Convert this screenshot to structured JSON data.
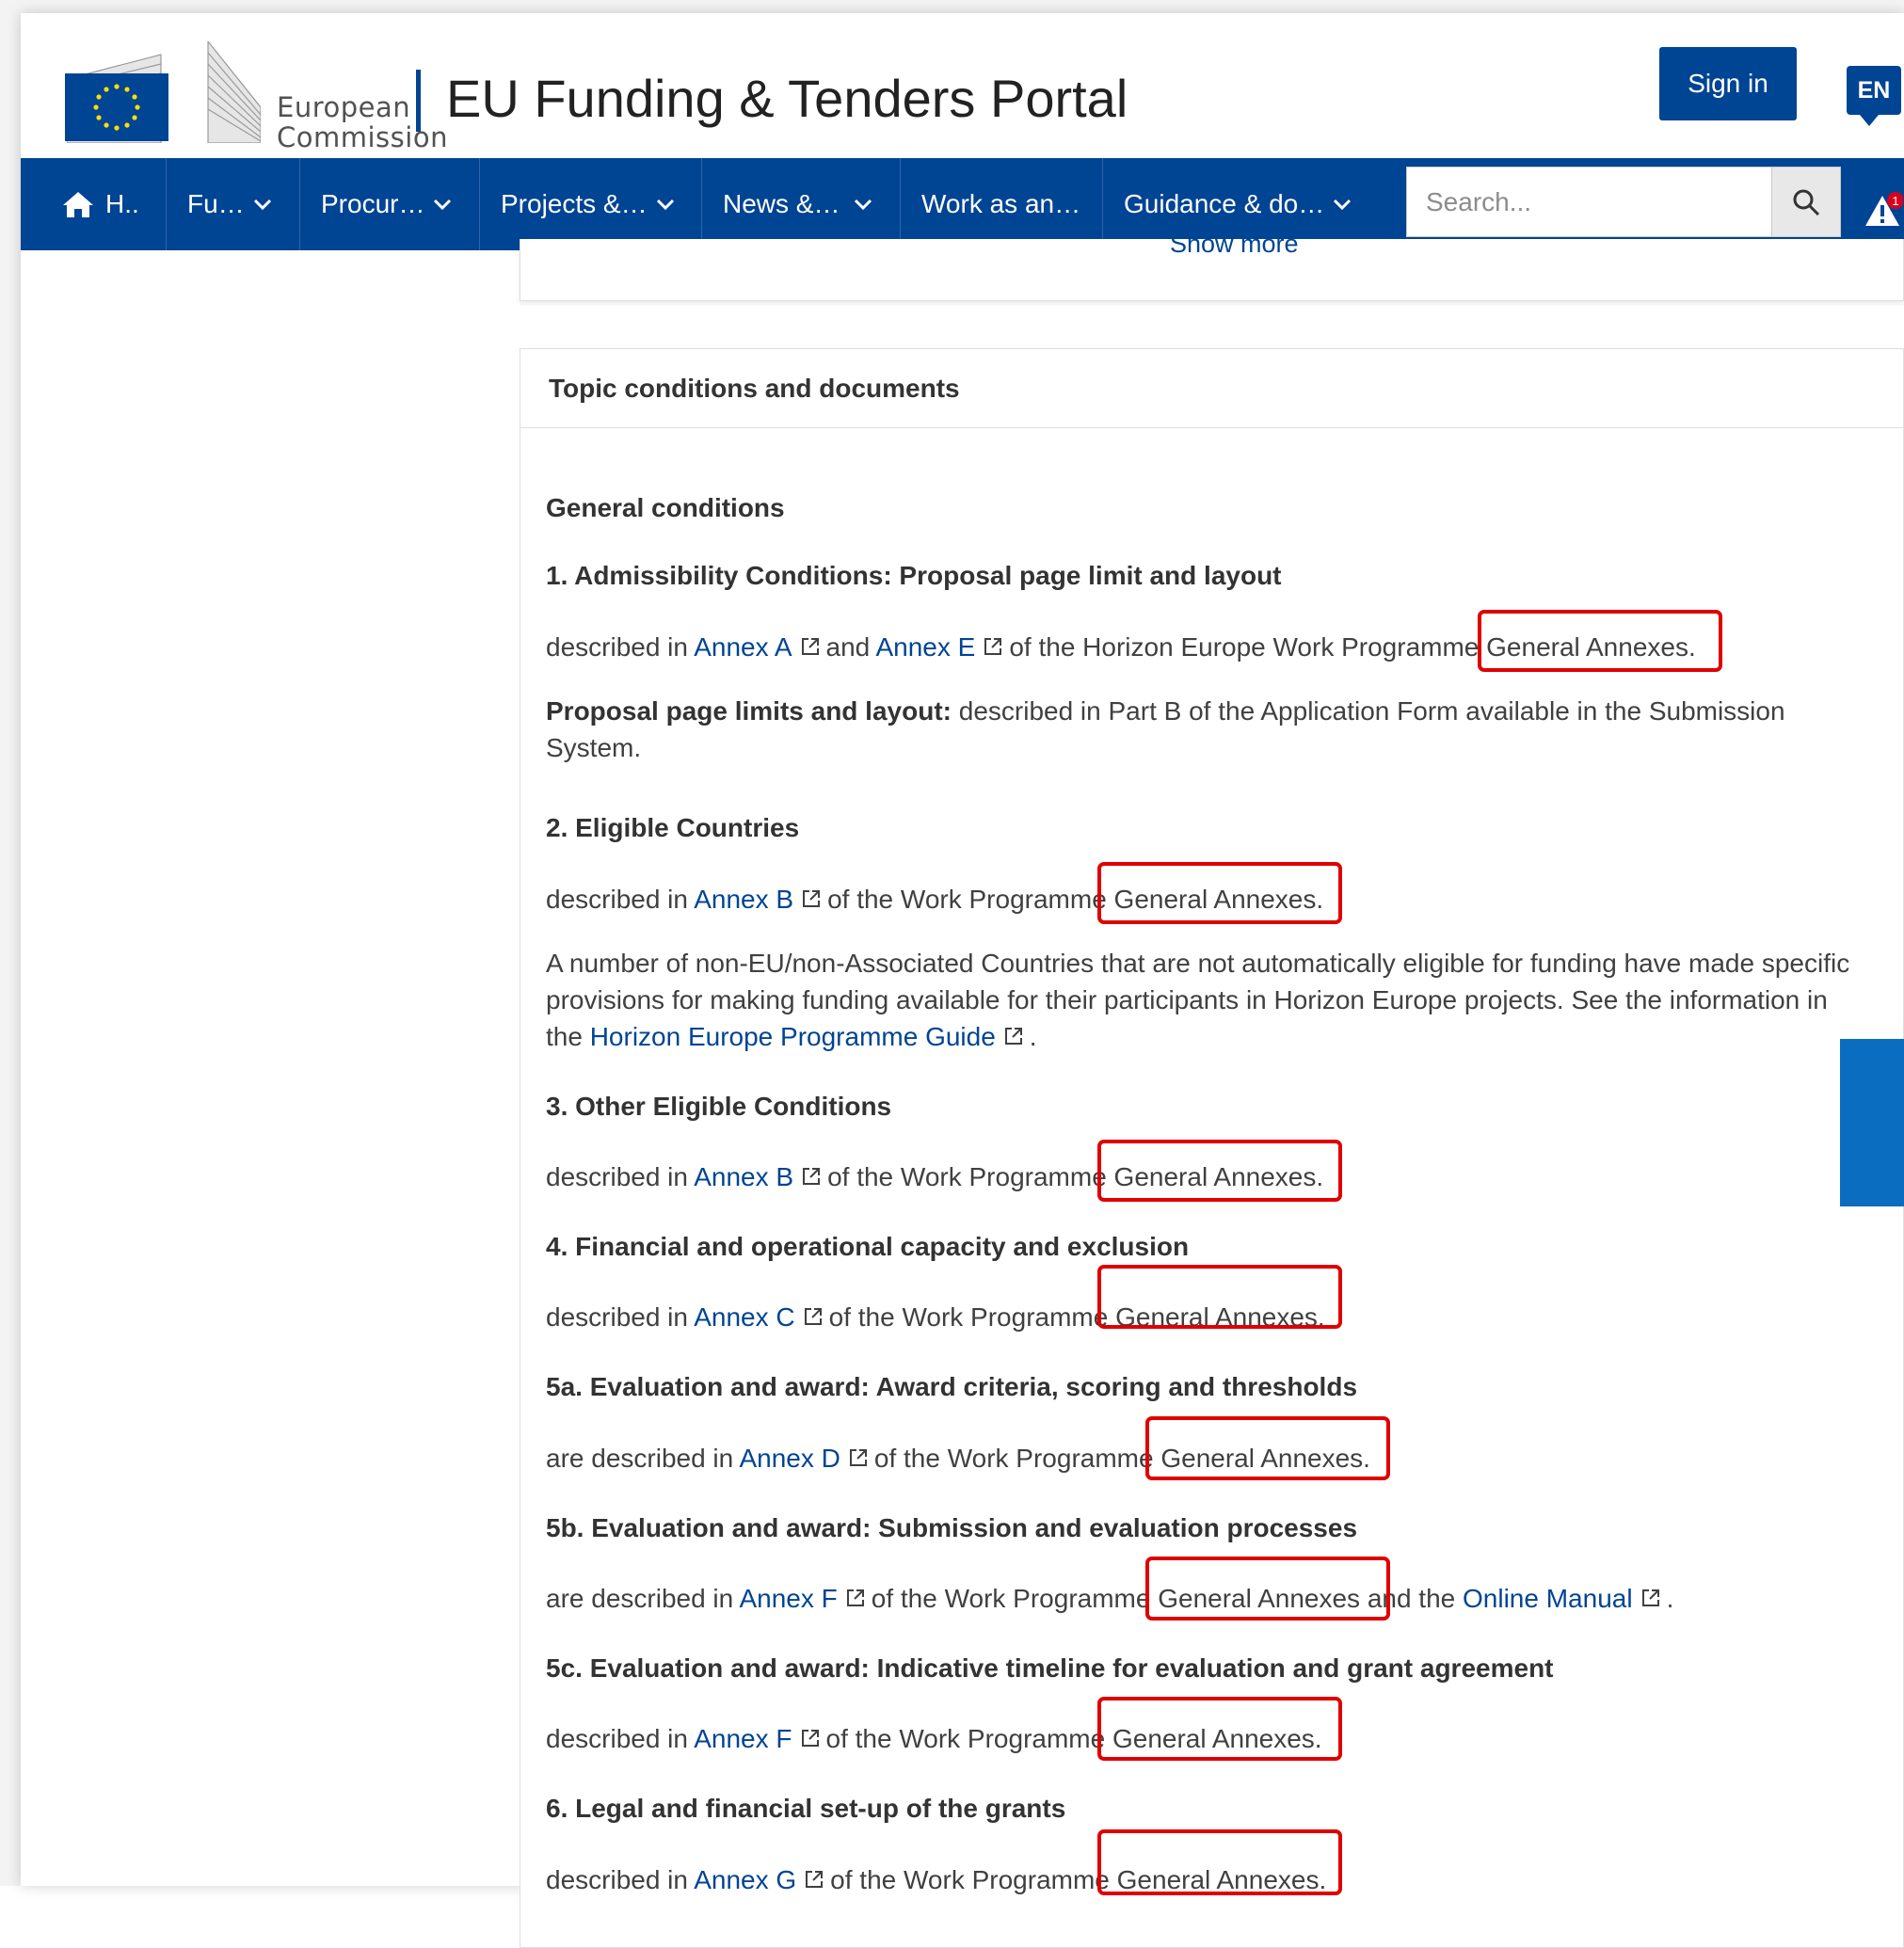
{
  "header": {
    "logo_line1": "European",
    "logo_line2": "Commission",
    "portal_title": "EU Funding & Tenders Portal",
    "sign_in": "Sign in",
    "language": "EN"
  },
  "nav": {
    "items": [
      {
        "label": "H..",
        "icon": "home-icon"
      },
      {
        "label": "Fu…",
        "dropdown": true
      },
      {
        "label": "Procur…",
        "dropdown": true
      },
      {
        "label": "Projects &…",
        "dropdown": true
      },
      {
        "label": "News &…",
        "dropdown": true
      },
      {
        "label": "Work as an…",
        "dropdown": false
      },
      {
        "label": "Guidance & do…",
        "dropdown": true
      }
    ],
    "search_placeholder": "Search...",
    "alert_count": "1"
  },
  "top_card": {
    "show_more": "Show more"
  },
  "card": {
    "title": "Topic conditions and documents",
    "general_conditions": "General conditions",
    "sections": [
      {
        "heading": "1. Admissibility Conditions: Proposal page limit and layout",
        "prefix": "described in ",
        "link1": "Annex A",
        "mid": "and",
        "link2": "Annex E",
        "suffix": "of the Horizon Europe Work Programme General Annexes.",
        "note_bold": "Proposal page limits and layout:",
        "note_line1": " described in Part B of the Application Form available in the Submission",
        "note_line2": "System."
      },
      {
        "heading": "2. Eligible Countries",
        "prefix": "described in ",
        "link": "Annex B",
        "suffix": "of the Work Programme General Annexes.",
        "para_line1": "A number of non-EU/non-Associated Countries that are not automatically eligible for funding have made specific",
        "para_line2": "provisions for making funding available for their participants in Horizon Europe projects. See the information in",
        "para_line3_prefix": "the ",
        "para_link": "Horizon Europe Programme Guide",
        "para_line3_suffix": "."
      },
      {
        "heading": "3. Other Eligible Conditions",
        "prefix": "described in ",
        "link": "Annex B",
        "suffix": "of the Work Programme General Annexes."
      },
      {
        "heading": "4. Financial and operational capacity and exclusion",
        "prefix": "described in ",
        "link": "Annex C",
        "suffix": "of the Work Programme General Annexes."
      },
      {
        "heading": "5a. Evaluation and award: Award criteria, scoring and thresholds",
        "prefix": "are described in ",
        "link": "Annex D",
        "suffix": "of the Work Programme General Annexes."
      },
      {
        "heading": "5b. Evaluation and award: Submission and evaluation processes",
        "prefix": "are described in ",
        "link": "Annex F",
        "suffix": "of the Work Programme General Annexes and the ",
        "link2": "Online Manual",
        "end": "."
      },
      {
        "heading": "5c. Evaluation and award: Indicative timeline for evaluation and grant agreement",
        "prefix": "described in ",
        "link": "Annex F",
        "suffix": "of the Work Programme General Annexes."
      },
      {
        "heading": "6. Legal and financial set-up of the grants",
        "prefix": "described in ",
        "link": "Annex G",
        "suffix": "of the Work Programme General Annexes."
      }
    ]
  },
  "colors": {
    "brand_blue": "#004494",
    "highlight_red": "#e00000",
    "side_tab_blue": "#0b6dbf"
  }
}
